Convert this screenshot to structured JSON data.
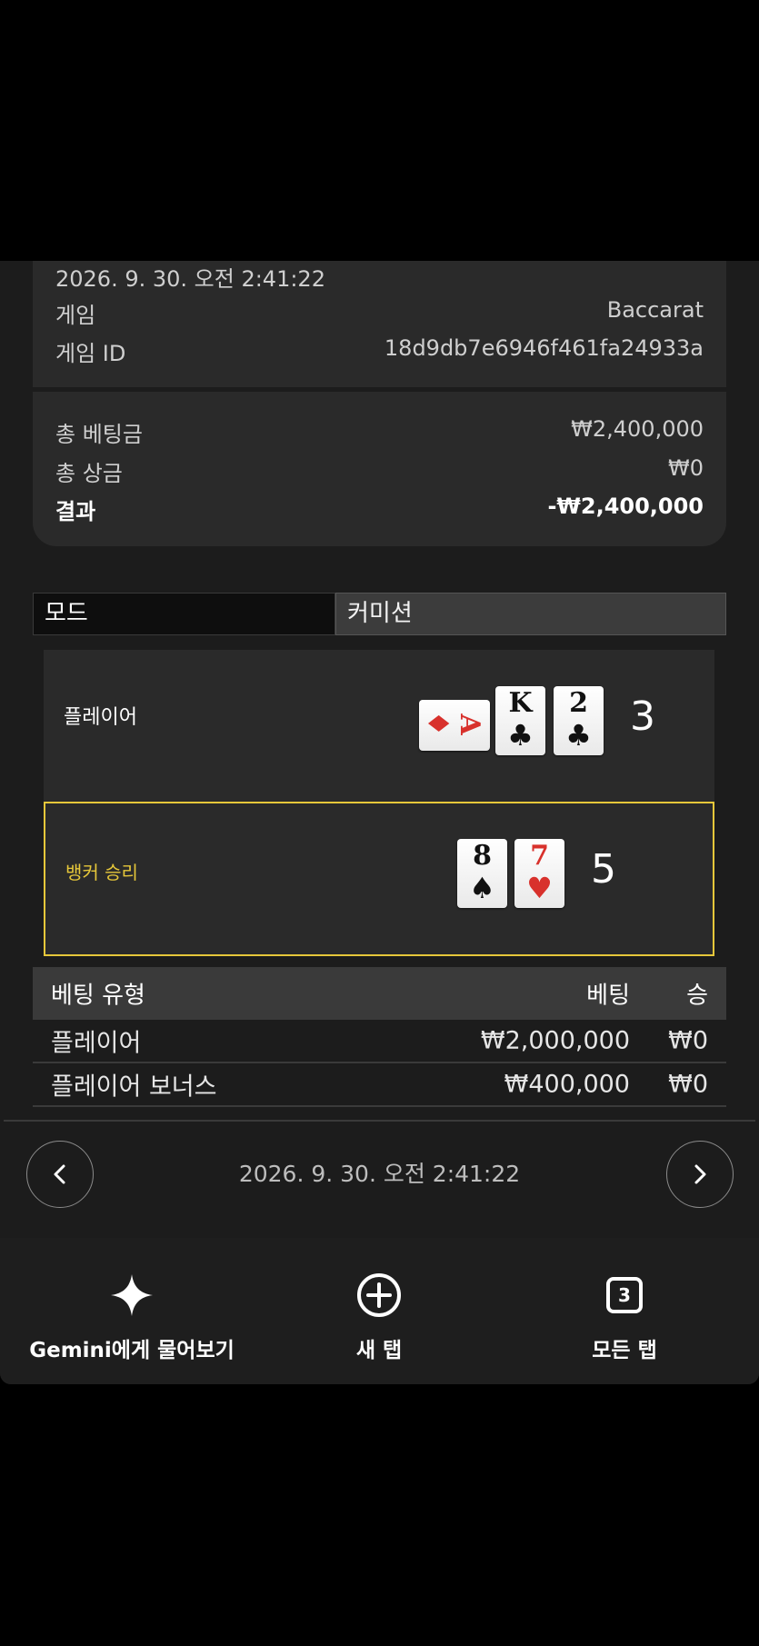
{
  "details": {
    "datetime": "2026. 9. 30. 오전 2:41:22",
    "game_label": "게임",
    "game_value": "Baccarat",
    "game_id_label": "게임 ID",
    "game_id_value": "18d9db7e6946f461fa24933a"
  },
  "totals": {
    "total_bet_label": "총 베팅금",
    "total_bet_value": "₩2,400,000",
    "total_win_label": "총 상금",
    "total_win_value": "₩0",
    "result_label": "결과",
    "result_value": "-₩2,400,000"
  },
  "tabs": {
    "mode": "모드",
    "commission": "커미션"
  },
  "player_hand": {
    "label": "플레이어",
    "score": "3",
    "cards": [
      {
        "rank": "A",
        "suit": "♦"
      },
      {
        "rank": "K",
        "suit": "♣"
      },
      {
        "rank": "2",
        "suit": "♣"
      }
    ]
  },
  "banker_hand": {
    "label": "뱅커 승리",
    "score": "5",
    "cards": [
      {
        "rank": "8",
        "suit": "♠"
      },
      {
        "rank": "7",
        "suit": "♥"
      }
    ]
  },
  "bets_table": {
    "headers": [
      "베팅 유형",
      "베팅",
      "승"
    ],
    "rows": [
      {
        "type": "플레이어",
        "bet": "₩2,000,000",
        "win": "₩0"
      },
      {
        "type": "플레이어 보너스",
        "bet": "₩400,000",
        "win": "₩0"
      }
    ]
  },
  "navigation": {
    "datetime": "2026. 9. 30. 오전 2:41:22",
    "prev_icon": "chevron-left-icon",
    "next_icon": "chevron-right-icon"
  },
  "bottom_bar": {
    "gemini_label": "Gemini에게 물어보기",
    "new_tab_label": "새 탭",
    "all_tabs_label": "모든 탭",
    "tab_count": "3"
  },
  "colors": {
    "winner_highlight": "#e6c73a",
    "red_suit": "#d8312c",
    "panel": "#2a2a2a",
    "background": "#1c1c1c"
  }
}
